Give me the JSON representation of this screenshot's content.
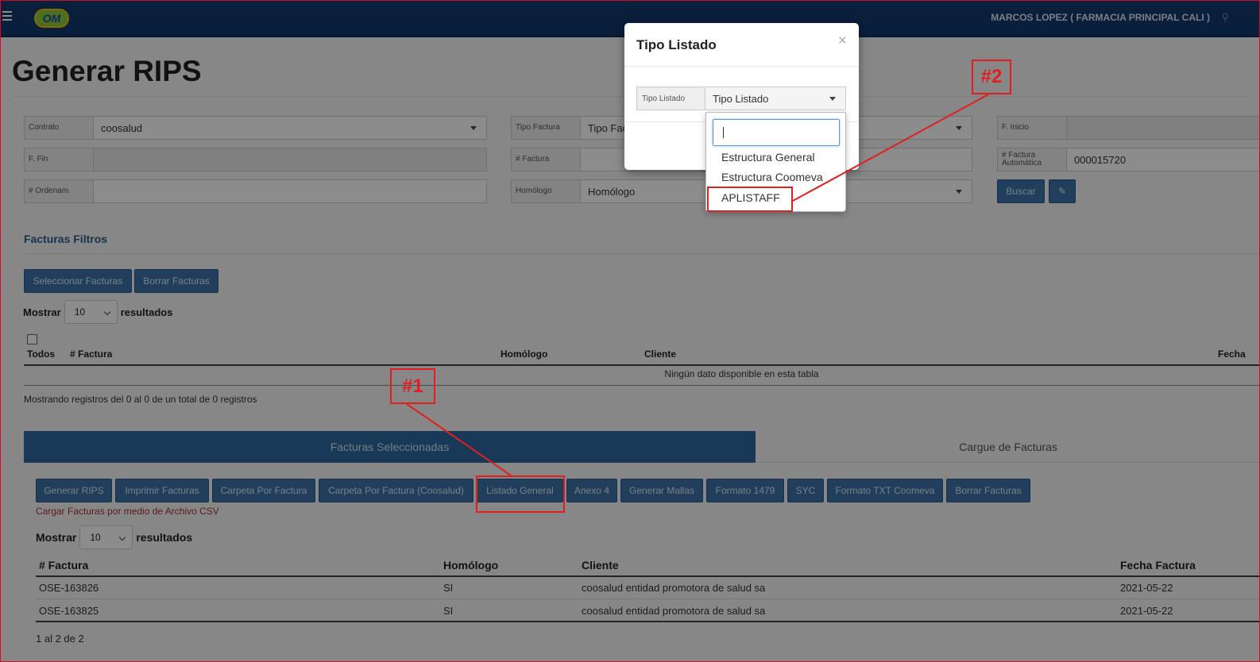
{
  "header": {
    "logo_text": "OM",
    "user": "MARCOS LOPEZ ( FARMACIA PRINCIPAL CALI )"
  },
  "page": {
    "title": "Generar RIPS"
  },
  "form": {
    "contrato": {
      "label": "Contrato",
      "value": "coosalud"
    },
    "f_fin": {
      "label": "F. Fin",
      "value": ""
    },
    "ordenam": {
      "label": "# Ordenam.",
      "value": ""
    },
    "tipo_factura": {
      "label": "Tipo Factura",
      "value": "Tipo Fac"
    },
    "num_factura": {
      "label": "# Factura",
      "value": ""
    },
    "homologo": {
      "label": "Homólogo",
      "value": "Homólogo"
    },
    "f_inicio": {
      "label": "F. Inicio",
      "value": ""
    },
    "factura_auto": {
      "label": "# Factura Automática",
      "value": "000015720"
    },
    "buscar_label": "Buscar"
  },
  "filtros": {
    "title": "Facturas Filtros",
    "seleccionar_label": "Seleccionar Facturas",
    "borrar_label": "Borrar Facturas",
    "mostrar": "Mostrar",
    "page_size": "10",
    "resultados": "resultados",
    "headers": {
      "todos": "Todos",
      "factura": "# Factura",
      "homologo": "Homólogo",
      "cliente": "Cliente",
      "fecha": "Fecha"
    },
    "empty": "Ningún dato disponible en esta tabla",
    "info": "Mostrando registros del 0 al 0 de un total de 0 registros"
  },
  "tabs": [
    {
      "label": "Facturas Seleccionadas",
      "active": true
    },
    {
      "label": "Cargue de Facturas",
      "active": false
    }
  ],
  "actions": [
    "Generar RIPS",
    "Imprimir Facturas",
    "Carpeta Por Factura",
    "Carpeta Por Factura (Coosalud)",
    "Listado General",
    "Anexo 4",
    "Generar Mallas",
    "Formato 1479",
    "SYC",
    "Formato TXT Coomeva",
    "Borrar Facturas"
  ],
  "csv_link": "Cargar Facturas por medio de Archivo CSV",
  "seleccionadas": {
    "mostrar": "Mostrar",
    "page_size": "10",
    "resultados": "resultados",
    "headers": {
      "factura": "# Factura",
      "homologo": "Homólogo",
      "cliente": "Cliente",
      "fecha": "Fecha Factura"
    },
    "rows": [
      {
        "factura": "OSE-163826",
        "homologo": "SI",
        "cliente": "coosalud entidad promotora de salud sa",
        "fecha": "2021-05-22"
      },
      {
        "factura": "OSE-163825",
        "homologo": "SI",
        "cliente": "coosalud entidad promotora de salud sa",
        "fecha": "2021-05-22"
      }
    ],
    "info": "1 al 2 de 2"
  },
  "modal": {
    "title": "Tipo Listado",
    "close": "×",
    "field_label": "Tipo Listado",
    "field_value": "Tipo Listado",
    "options": [
      "Estructura General",
      "Estructura Coomeva",
      "APLISTAFF"
    ]
  },
  "annotations": {
    "one": "#1",
    "two": "#2"
  },
  "colors": {
    "primary": "#3c74a8",
    "header": "#133a6e",
    "annotation": "#e02020"
  }
}
